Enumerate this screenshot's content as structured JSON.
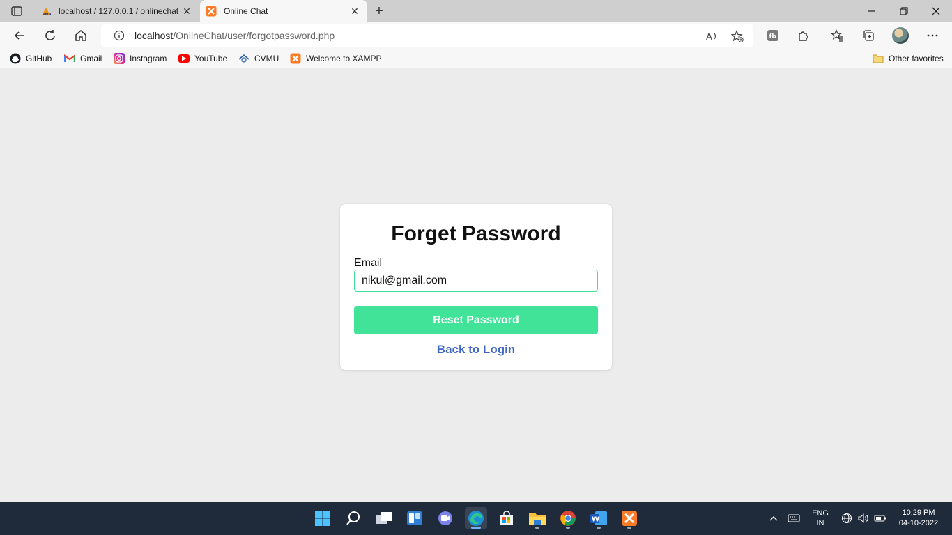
{
  "browser": {
    "tabs": [
      {
        "title": "localhost / 127.0.0.1 / onlinechat",
        "icon": "phpmyadmin-icon",
        "active": false
      },
      {
        "title": "Online Chat",
        "icon": "xampp-icon",
        "active": true
      }
    ],
    "address": {
      "host": "localhost",
      "path": "/OnlineChat/user/forgotpassword.php"
    },
    "bookmarks": [
      {
        "label": "GitHub",
        "icon": "github-icon"
      },
      {
        "label": "Gmail",
        "icon": "gmail-icon"
      },
      {
        "label": "Instagram",
        "icon": "instagram-icon"
      },
      {
        "label": "YouTube",
        "icon": "youtube-icon"
      },
      {
        "label": "CVMU",
        "icon": "cvmu-icon"
      },
      {
        "label": "Welcome to XAMPP",
        "icon": "xampp-icon"
      }
    ],
    "other_favorites": "Other favorites"
  },
  "form": {
    "title": "Forget Password",
    "email_label": "Email",
    "email_value": "nikul@gmail.com",
    "submit_label": "Reset Password",
    "back_link": "Back to Login",
    "accent_color": "#40e397",
    "link_color": "#4167c4"
  },
  "taskbar": {
    "language": "ENG",
    "region": "IN",
    "time": "10:29 PM",
    "date": "04-10-2022"
  }
}
